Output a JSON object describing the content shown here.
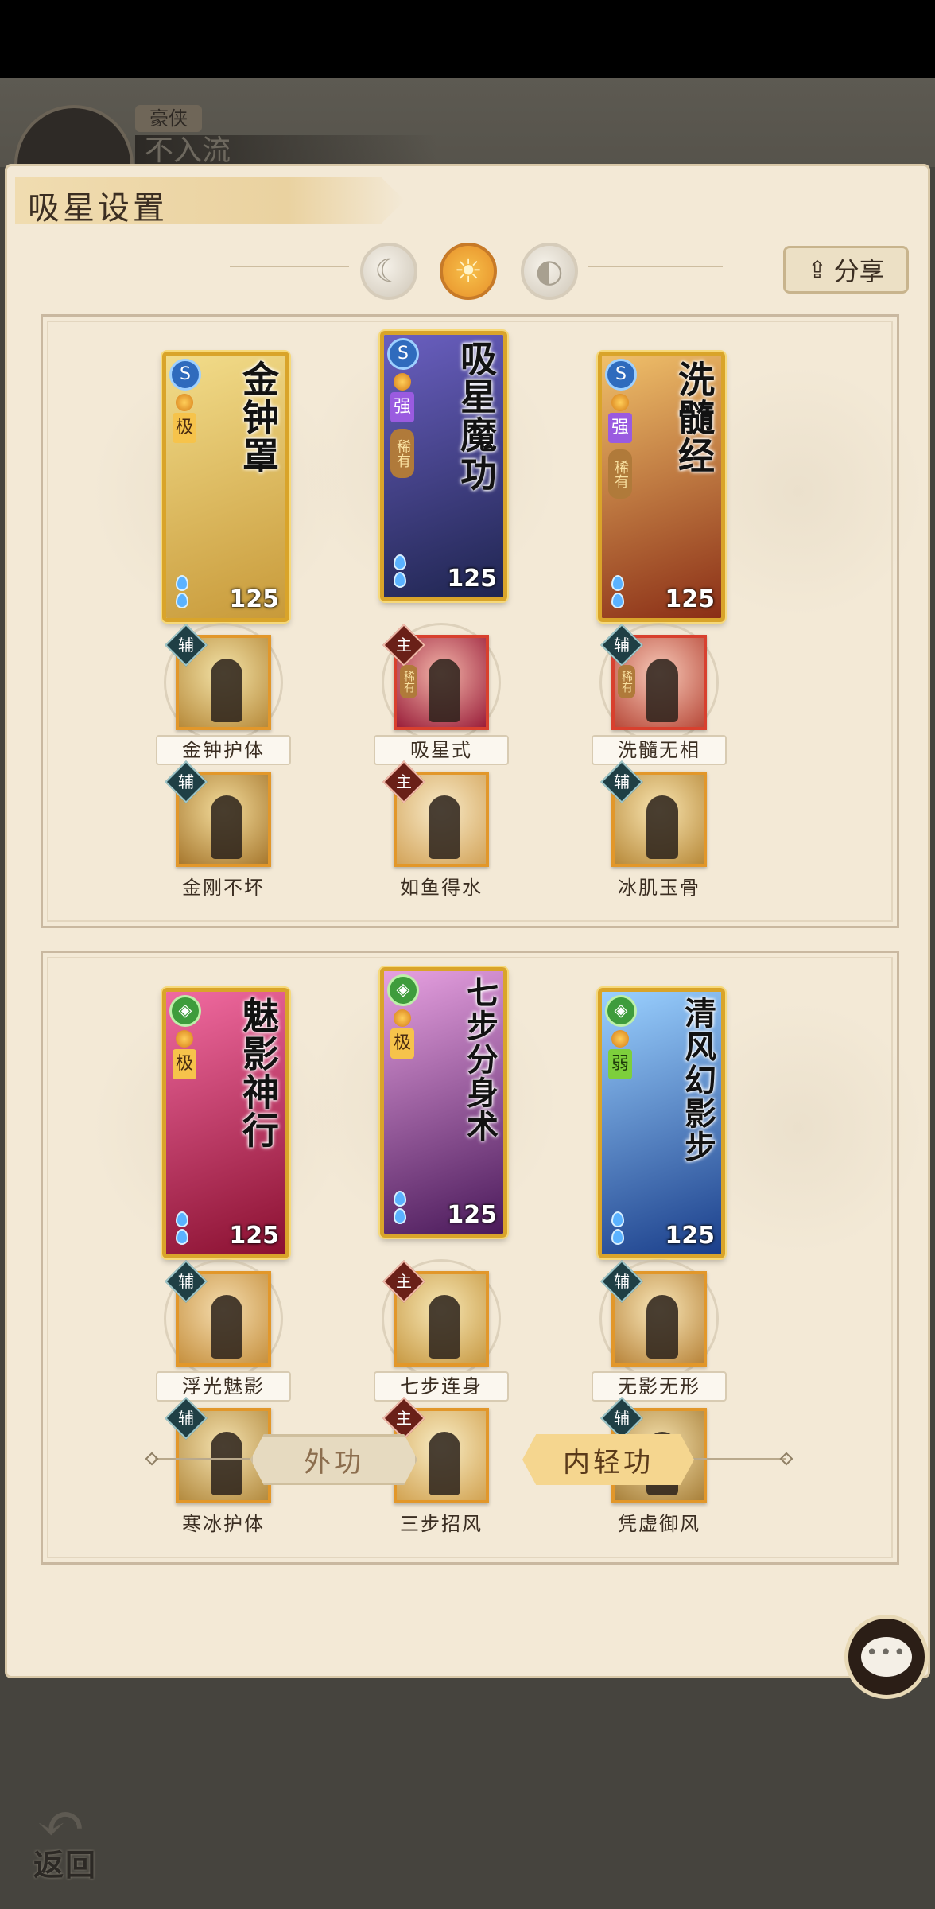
{
  "background": {
    "rank_label": "豪侠",
    "player_name": "不入流"
  },
  "header": {
    "title": "吸星设置",
    "share_label": "分享",
    "share_icon": "share-icon"
  },
  "mode_toggles": [
    {
      "icon": "moon-icon",
      "active": false
    },
    {
      "icon": "sun-icon",
      "active": true
    },
    {
      "icon": "eclipse-icon",
      "active": false
    }
  ],
  "sections": [
    {
      "cards": [
        {
          "name": "金钟罩",
          "tier": "极",
          "rarity": "",
          "level": "125",
          "element": "blue",
          "art_colors": [
            "#f2dc8a",
            "#c89a3a"
          ]
        },
        {
          "name": "吸星魔功",
          "tier": "强",
          "rarity": "稀有",
          "level": "125",
          "element": "blue",
          "art_colors": [
            "#6a5fc0",
            "#1f2550"
          ]
        },
        {
          "name": "洗髓经",
          "tier": "强",
          "rarity": "稀有",
          "level": "125",
          "element": "blue",
          "art_colors": [
            "#f0c06a",
            "#8a2e16"
          ]
        }
      ],
      "skills_row1": [
        {
          "name": "金钟护体",
          "role": "辅",
          "rarity": "",
          "border": "gold",
          "colors": [
            "#f3e3a8",
            "#b78a3a"
          ]
        },
        {
          "name": "吸星式",
          "role": "主",
          "rarity": "稀有",
          "border": "red",
          "colors": [
            "#f2b4a8",
            "#9a1e3a"
          ]
        },
        {
          "name": "洗髓无相",
          "role": "辅",
          "rarity": "稀有",
          "border": "red",
          "colors": [
            "#f7c9b8",
            "#b84a3a"
          ]
        }
      ],
      "skills_row2": [
        {
          "name": "金刚不坏",
          "role": "辅",
          "border": "gold",
          "colors": [
            "#f3dc9c",
            "#a7782e"
          ]
        },
        {
          "name": "如鱼得水",
          "role": "主",
          "border": "gold",
          "colors": [
            "#f8eac8",
            "#d3a45a"
          ]
        },
        {
          "name": "冰肌玉骨",
          "role": "辅",
          "border": "gold",
          "colors": [
            "#f8e4b0",
            "#b88a3a"
          ]
        }
      ]
    },
    {
      "cards": [
        {
          "name": "魅影神行",
          "tier": "极",
          "rarity": "",
          "level": "125",
          "element": "green",
          "art_colors": [
            "#f06aa0",
            "#8a1030"
          ]
        },
        {
          "name": "七步分身术",
          "tier": "极",
          "rarity": "",
          "level": "125",
          "element": "green",
          "art_colors": [
            "#e6a0e0",
            "#4a1a5a"
          ]
        },
        {
          "name": "清风幻影步",
          "tier": "弱",
          "rarity": "",
          "level": "125",
          "element": "green",
          "art_colors": [
            "#9ad0ff",
            "#1a3e8a"
          ]
        }
      ],
      "skills_row1": [
        {
          "name": "浮光魅影",
          "role": "辅",
          "rarity": "",
          "border": "gold",
          "colors": [
            "#f4dcae",
            "#c6903e"
          ]
        },
        {
          "name": "七步连身",
          "role": "主",
          "rarity": "",
          "border": "gold",
          "colors": [
            "#f6e6b4",
            "#c89a44"
          ]
        },
        {
          "name": "无影无形",
          "role": "辅",
          "rarity": "",
          "border": "gold",
          "colors": [
            "#f8e6b8",
            "#b8843a"
          ]
        }
      ],
      "skills_row2": [
        {
          "name": "寒冰护体",
          "role": "辅",
          "border": "gold",
          "colors": [
            "#f4e2b0",
            "#b38a3e"
          ]
        },
        {
          "name": "三步招风",
          "role": "主",
          "border": "gold",
          "colors": [
            "#f8ecc4",
            "#d2a352"
          ]
        },
        {
          "name": "凭虚御风",
          "role": "辅",
          "border": "gold",
          "colors": [
            "#f6e2ae",
            "#a8803a"
          ]
        }
      ]
    }
  ],
  "bottom_tabs": [
    {
      "label": "外功",
      "active": false
    },
    {
      "label": "内轻功",
      "active": true
    }
  ],
  "chat_button": {
    "icon": "chat-bubble-icon",
    "glyph": "•••"
  },
  "back_button": {
    "label": "返回",
    "icon": "back-arrow-icon"
  }
}
